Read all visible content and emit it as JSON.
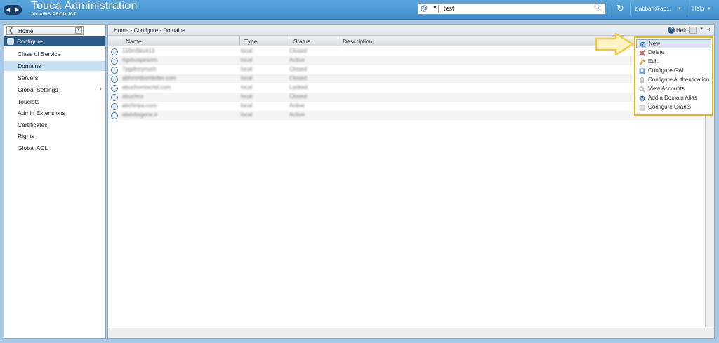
{
  "app": {
    "title": "Touca Administration",
    "subtitle": "AN ARIS PRODUCT"
  },
  "topbar": {
    "search_type_icon": "at-icon",
    "search_value": "test",
    "user": "zjabbari@ap...",
    "help_label": "Help"
  },
  "sidebar": {
    "home_label": "Home",
    "section_label": "Configure",
    "items": [
      {
        "label": "Class of Service",
        "selected": false
      },
      {
        "label": "Domains",
        "selected": true
      },
      {
        "label": "Servers",
        "selected": false
      },
      {
        "label": "Global Settings",
        "selected": false,
        "has_submenu": true
      },
      {
        "label": "Toucl​ets",
        "selected": false
      },
      {
        "label": "Admin Extensions",
        "selected": false
      },
      {
        "label": "Certificates",
        "selected": false
      },
      {
        "label": "Rights",
        "selected": false
      },
      {
        "label": "Global ACL",
        "selected": false
      }
    ]
  },
  "main": {
    "breadcrumb": "Home - Configure - Domains",
    "help_label": "Help",
    "columns": [
      "Name",
      "Type",
      "Status",
      "Description"
    ],
    "rows": [
      {
        "name": "110mSkv413",
        "type": "local",
        "status": "Closed",
        "description": ""
      },
      {
        "name": "4gsbuspesom",
        "type": "local",
        "status": "Active",
        "description": ""
      },
      {
        "name": "7pgdmrynuch",
        "type": "local",
        "status": "Closed",
        "description": ""
      },
      {
        "name": "abhmmbomletter.com",
        "type": "local",
        "status": "Closed",
        "description": ""
      },
      {
        "name": "abuchomiscrtd.com",
        "type": "local",
        "status": "Locked",
        "description": ""
      },
      {
        "name": "abuchnx",
        "type": "local",
        "status": "Closed",
        "description": ""
      },
      {
        "name": "abchrrpa.com",
        "type": "local",
        "status": "Active",
        "description": ""
      },
      {
        "name": "abdvbsgene.ir",
        "type": "local",
        "status": "Active",
        "description": ""
      }
    ]
  },
  "context_menu": {
    "items": [
      {
        "label": "New",
        "icon": "new-domain-icon",
        "highlighted": true
      },
      {
        "label": "Delete",
        "icon": "delete-icon",
        "highlighted": false
      },
      {
        "label": "Edit",
        "icon": "edit-icon",
        "highlighted": false
      },
      {
        "label": "Configure GAL",
        "icon": "gal-icon",
        "highlighted": false
      },
      {
        "label": "Configure Authentication",
        "icon": "auth-icon",
        "highlighted": false
      },
      {
        "label": "View Accounts",
        "icon": "accounts-icon",
        "highlighted": false
      },
      {
        "label": "Add a Domain Alias",
        "icon": "alias-icon",
        "highlighted": false
      },
      {
        "label": "Configure Grants",
        "icon": "grants-icon",
        "highlighted": false
      }
    ]
  },
  "colors": {
    "topbar": "#4a98d4",
    "frame": "#a9c8e3",
    "selected_nav": "#c7dff3",
    "section_header": "#2d5c8b",
    "highlight_border": "#e6b820",
    "arrow": "#f2c744"
  }
}
